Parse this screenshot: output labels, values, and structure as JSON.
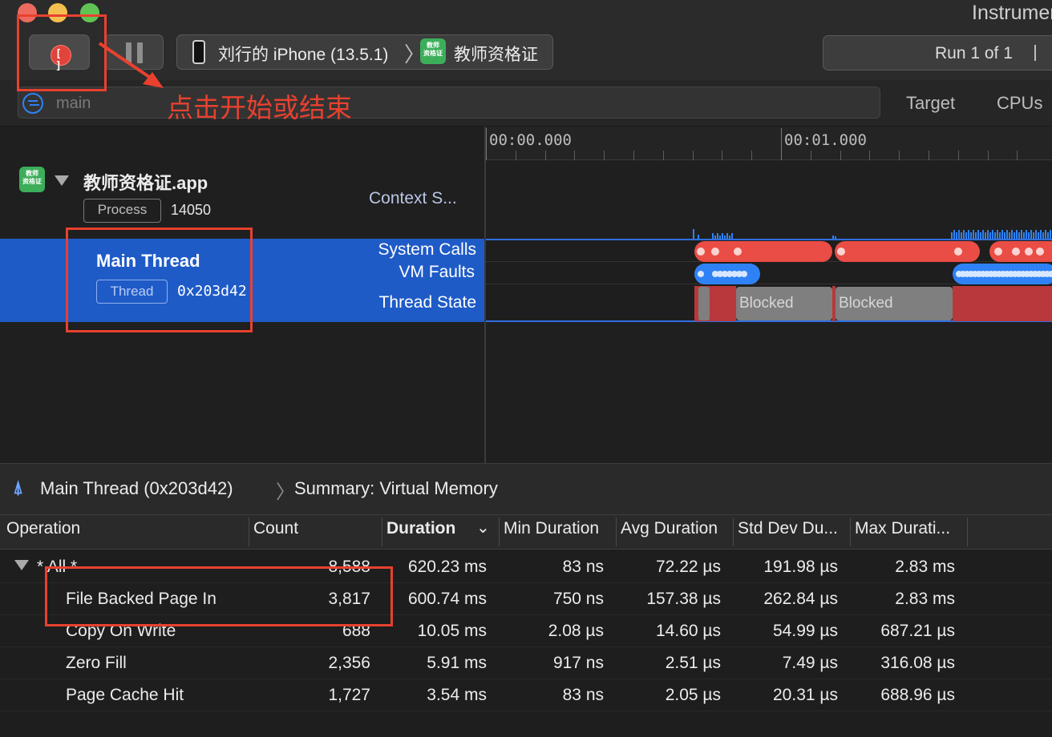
{
  "window": {
    "title": "Instruments"
  },
  "toolbar": {
    "device": "刘行的 iPhone (13.5.1)",
    "app": "教师资格证",
    "run": "Run 1 of 1",
    "app_icon_line1": "教师",
    "app_icon_line2": "资格证"
  },
  "filter": {
    "placeholder": "main"
  },
  "tabs": {
    "target": "Target",
    "cpus": "CPUs"
  },
  "annotation": {
    "text": "点击开始或结束"
  },
  "timeline": {
    "ticks": [
      "00:00.000",
      "00:01.000"
    ],
    "process": {
      "name": "教师资格证.app",
      "badge": "Process",
      "pid": "14050",
      "track": "Context S..."
    },
    "thread": {
      "name": "Main Thread",
      "badge": "Thread",
      "address": "0x203d42",
      "tracks": [
        "System Calls",
        "VM Faults",
        "Thread State"
      ],
      "state_labels": [
        "Blocked",
        "Blocked"
      ]
    }
  },
  "detail": {
    "breadcrumb": [
      "Main Thread (0x203d42)",
      "Summary: Virtual Memory"
    ],
    "columns": [
      "Operation",
      "Count",
      "Duration",
      "Min Duration",
      "Avg Duration",
      "Std Dev Du...",
      "Max Durati..."
    ],
    "rows": [
      {
        "op": "* All *",
        "count": "8,588",
        "duration": "620.23 ms",
        "min": "83 ns",
        "avg": "72.22 µs",
        "std": "191.98 µs",
        "max": "2.83 ms"
      },
      {
        "op": "File Backed Page In",
        "count": "3,817",
        "duration": "600.74 ms",
        "min": "750 ns",
        "avg": "157.38 µs",
        "std": "262.84 µs",
        "max": "2.83 ms"
      },
      {
        "op": "Copy On Write",
        "count": "688",
        "duration": "10.05 ms",
        "min": "2.08 µs",
        "avg": "14.60 µs",
        "std": "54.99 µs",
        "max": "687.21 µs"
      },
      {
        "op": "Zero Fill",
        "count": "2,356",
        "duration": "5.91 ms",
        "min": "917 ns",
        "avg": "2.51 µs",
        "std": "7.49 µs",
        "max": "316.08 µs"
      },
      {
        "op": "Page Cache Hit",
        "count": "1,727",
        "duration": "3.54 ms",
        "min": "83 ns",
        "avg": "2.05 µs",
        "std": "20.31 µs",
        "max": "688.96 µs"
      }
    ]
  },
  "colors": {
    "accent": "#2f82f5",
    "record": "#e0443a",
    "annotation": "#e8412f",
    "selection": "#1f5bc7"
  }
}
